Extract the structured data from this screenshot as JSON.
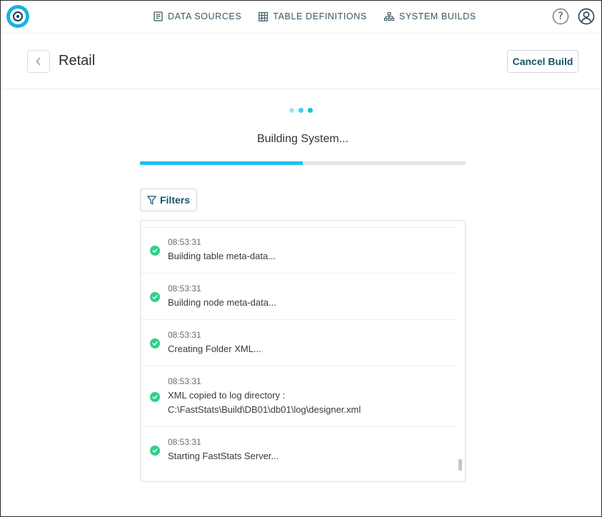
{
  "nav": {
    "links": [
      {
        "label": "DATA SOURCES",
        "icon": "document-icon"
      },
      {
        "label": "TABLE DEFINITIONS",
        "icon": "grid-icon"
      },
      {
        "label": "SYSTEM BUILDS",
        "icon": "hierarchy-icon"
      }
    ],
    "help_glyph": "?"
  },
  "header": {
    "title": "Retail",
    "cancel_label": "Cancel Build"
  },
  "build": {
    "status": "Building System...",
    "progress_fraction": 0.5
  },
  "filters": {
    "label": "Filters"
  },
  "log": [
    {
      "time": "08:53:31",
      "lines": [
        "Building table meta-data..."
      ]
    },
    {
      "time": "08:53:31",
      "lines": [
        "Building node meta-data..."
      ]
    },
    {
      "time": "08:53:31",
      "lines": [
        "Creating Folder XML..."
      ]
    },
    {
      "time": "08:53:31",
      "lines": [
        "XML copied to log directory :",
        "C:\\FastStats\\Build\\DB01\\db01\\log\\designer.xml"
      ]
    },
    {
      "time": "08:53:31",
      "lines": [
        "Starting FastStats Server..."
      ]
    }
  ],
  "colors": {
    "accent": "#1ec1ec",
    "success": "#2fd08e",
    "link": "#17556d",
    "loader_dots": [
      "#9fe3f5",
      "#43cdf0",
      "#18bde9"
    ]
  }
}
